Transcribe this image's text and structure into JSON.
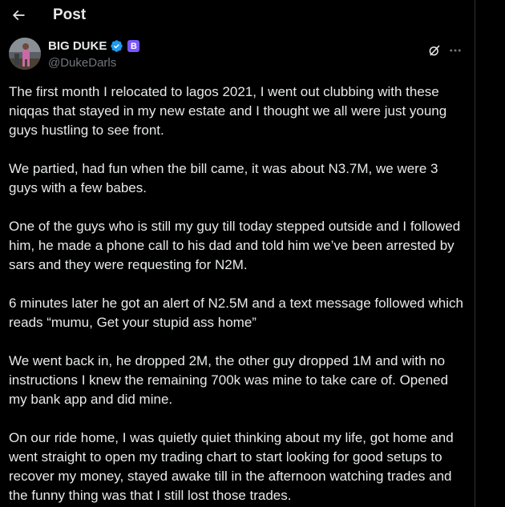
{
  "header": {
    "title": "Post"
  },
  "author": {
    "display_name": "BIG DUKE",
    "handle": "@DukeDarls",
    "badge_letter": "B",
    "verified_color": "#1d9bf0",
    "badge_color": "#7856ff"
  },
  "icons": {
    "back": "back-arrow-icon",
    "verified": "verified-badge-icon",
    "grok": "grok-icon",
    "more": "more-options-icon"
  },
  "tweet": {
    "paragraphs": [
      "The first month I relocated to lagos 2021, I went out clubbing with these niqqas that stayed in my new estate and I thought we all were just young guys hustling to see front.",
      "We partied, had fun when the bill came, it was about N3.7M, we were 3 guys with a few babes.",
      "One of the guys who is still my guy till today stepped outside and I followed him, he made a phone call to his dad and told him we’ve been arrested by sars and they were requesting for N2M.",
      "6 minutes later he got an alert of N2.5M and a text message followed which reads “mumu, Get your stupid ass home”",
      "We went back in, he dropped 2M, the other guy dropped 1M and with no instructions I knew the remaining 700k was mine to take care of. Opened my bank app and did mine.",
      "On our ride home, I was quietly quiet thinking about my life, got home and went straight to open my trading chart to start looking for good setups to recover my money, stayed awake till in the afternoon watching trades and the funny thing was that I still lost those trades."
    ]
  }
}
